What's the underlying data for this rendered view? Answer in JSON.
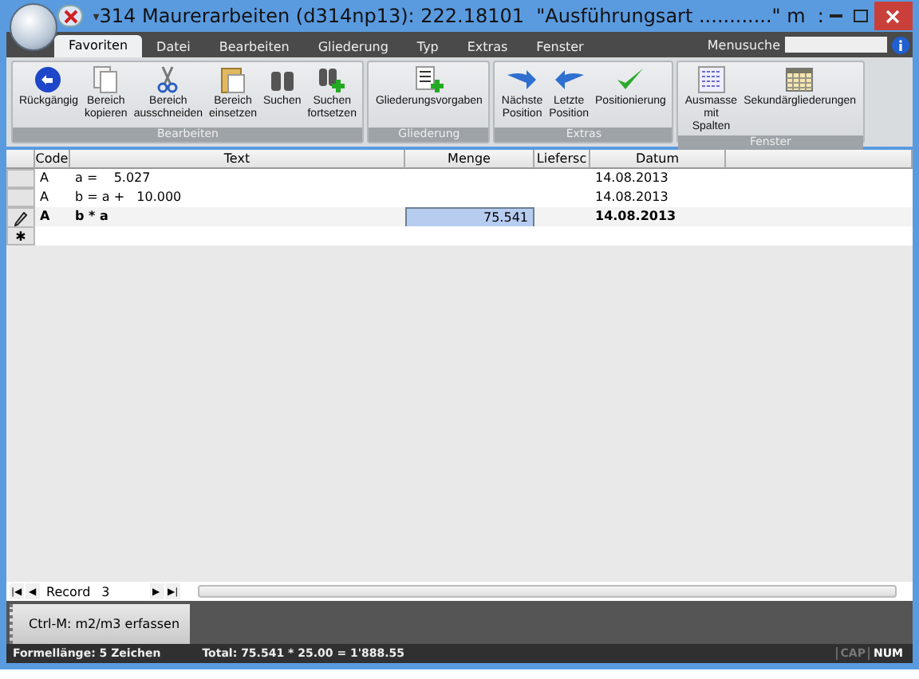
{
  "window": {
    "title": "314 Maurerarbeiten (d314np13): 222.18101  \"Ausführungsart ............\" m  :",
    "qat_icon": "▾"
  },
  "tabs": [
    {
      "label": "Favoriten",
      "selected": true
    },
    {
      "label": "Datei",
      "selected": false
    },
    {
      "label": "Bearbeiten",
      "selected": false
    },
    {
      "label": "Gliederung",
      "selected": false
    },
    {
      "label": "Typ",
      "selected": false
    },
    {
      "label": "Extras",
      "selected": false
    },
    {
      "label": "Fenster",
      "selected": false
    }
  ],
  "menu_search": {
    "label": "Menusuche"
  },
  "ribbon_groups": [
    {
      "title": "Bearbeiten",
      "buttons": [
        {
          "kind": "undo",
          "label": "Rückgängig"
        },
        {
          "kind": "copy",
          "label": "Bereich kopieren"
        },
        {
          "kind": "cut",
          "label": "Bereich ausschneiden"
        },
        {
          "kind": "paste",
          "label": "Bereich einsetzen"
        },
        {
          "kind": "find",
          "label": "Suchen"
        },
        {
          "kind": "findnext",
          "label": "Suchen fortsetzen"
        }
      ]
    },
    {
      "title": "Gliederung",
      "buttons": [
        {
          "kind": "outline",
          "label": "Gliederungsvorgaben"
        }
      ]
    },
    {
      "title": "Extras",
      "buttons": [
        {
          "kind": "next",
          "label": "Nächste Position"
        },
        {
          "kind": "prev",
          "label": "Letzte Position"
        },
        {
          "kind": "check",
          "label": "Positionierung"
        }
      ]
    },
    {
      "title": "Fenster",
      "buttons": [
        {
          "kind": "columns",
          "label": "Ausmasse mit Spalten"
        },
        {
          "kind": "table",
          "label": "Sekundärgliederungen"
        }
      ]
    }
  ],
  "table": {
    "columns": [
      "Code",
      "Text",
      "Menge",
      "Liefersc",
      "Datum"
    ],
    "rows": [
      {
        "kind": "data",
        "selected": false,
        "code": "A",
        "text": "a =    5.027",
        "menge": "",
        "datum": "14.08.2013"
      },
      {
        "kind": "data",
        "selected": false,
        "code": "A",
        "text": "b = a +   10.000",
        "menge": "",
        "datum": "14.08.2013"
      },
      {
        "kind": "data",
        "selected": true,
        "code": "A",
        "text": "b * a",
        "menge": "75.541",
        "datum": "14.08.2013"
      },
      {
        "kind": "new",
        "selected": false,
        "marker": "✱"
      }
    ]
  },
  "record_nav": {
    "label": "Record",
    "value": "3",
    "first": "|◀",
    "previous": "◀",
    "next": "▶",
    "last": "▶|"
  },
  "shortcut_button": {
    "label": "Ctrl-M: m2/m3 erfassen"
  },
  "status_bar": {
    "formula_length": "Formellänge: 5 Zeichen",
    "total": "Total: 75.541 * 25.00 = 1'888.55",
    "indicators": [
      {
        "label": "CAP",
        "active": false
      },
      {
        "label": "NUM",
        "active": true
      }
    ]
  }
}
